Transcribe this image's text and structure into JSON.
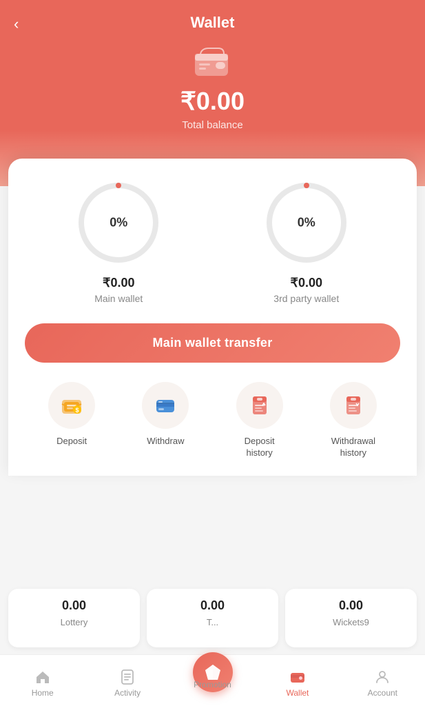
{
  "header": {
    "title": "Wallet",
    "back_label": "‹",
    "balance": "₹0.00",
    "balance_label": "Total balance"
  },
  "wallets": [
    {
      "id": "main",
      "percent": "0%",
      "amount": "₹0.00",
      "name": "Main wallet"
    },
    {
      "id": "third-party",
      "percent": "0%",
      "amount": "₹0.00",
      "name": "3rd party wallet"
    }
  ],
  "transfer_button": {
    "label": "Main wallet transfer"
  },
  "actions": [
    {
      "id": "deposit",
      "label": "Deposit",
      "icon": "deposit"
    },
    {
      "id": "withdraw",
      "label": "Withdraw",
      "icon": "withdraw"
    },
    {
      "id": "deposit-history",
      "label": "Deposit\nhistory",
      "icon": "deposit-history"
    },
    {
      "id": "withdrawal-history",
      "label": "Withdrawal\nhistory",
      "icon": "withdrawal-history"
    }
  ],
  "sub_wallets": [
    {
      "amount": "0.00",
      "label": "Lottery"
    },
    {
      "amount": "0.00",
      "label": "T..."
    },
    {
      "amount": "0.00",
      "label": "Wickets9"
    }
  ],
  "nav": {
    "items": [
      {
        "id": "home",
        "label": "Home",
        "active": false
      },
      {
        "id": "activity",
        "label": "Activity",
        "active": false
      },
      {
        "id": "promotion",
        "label": "Promotion",
        "active": false,
        "center": true
      },
      {
        "id": "wallet",
        "label": "Wallet",
        "active": true
      },
      {
        "id": "account",
        "label": "Account",
        "active": false
      }
    ]
  },
  "colors": {
    "primary": "#e8675a",
    "active_nav": "#e8675a",
    "inactive_nav": "#999999"
  }
}
